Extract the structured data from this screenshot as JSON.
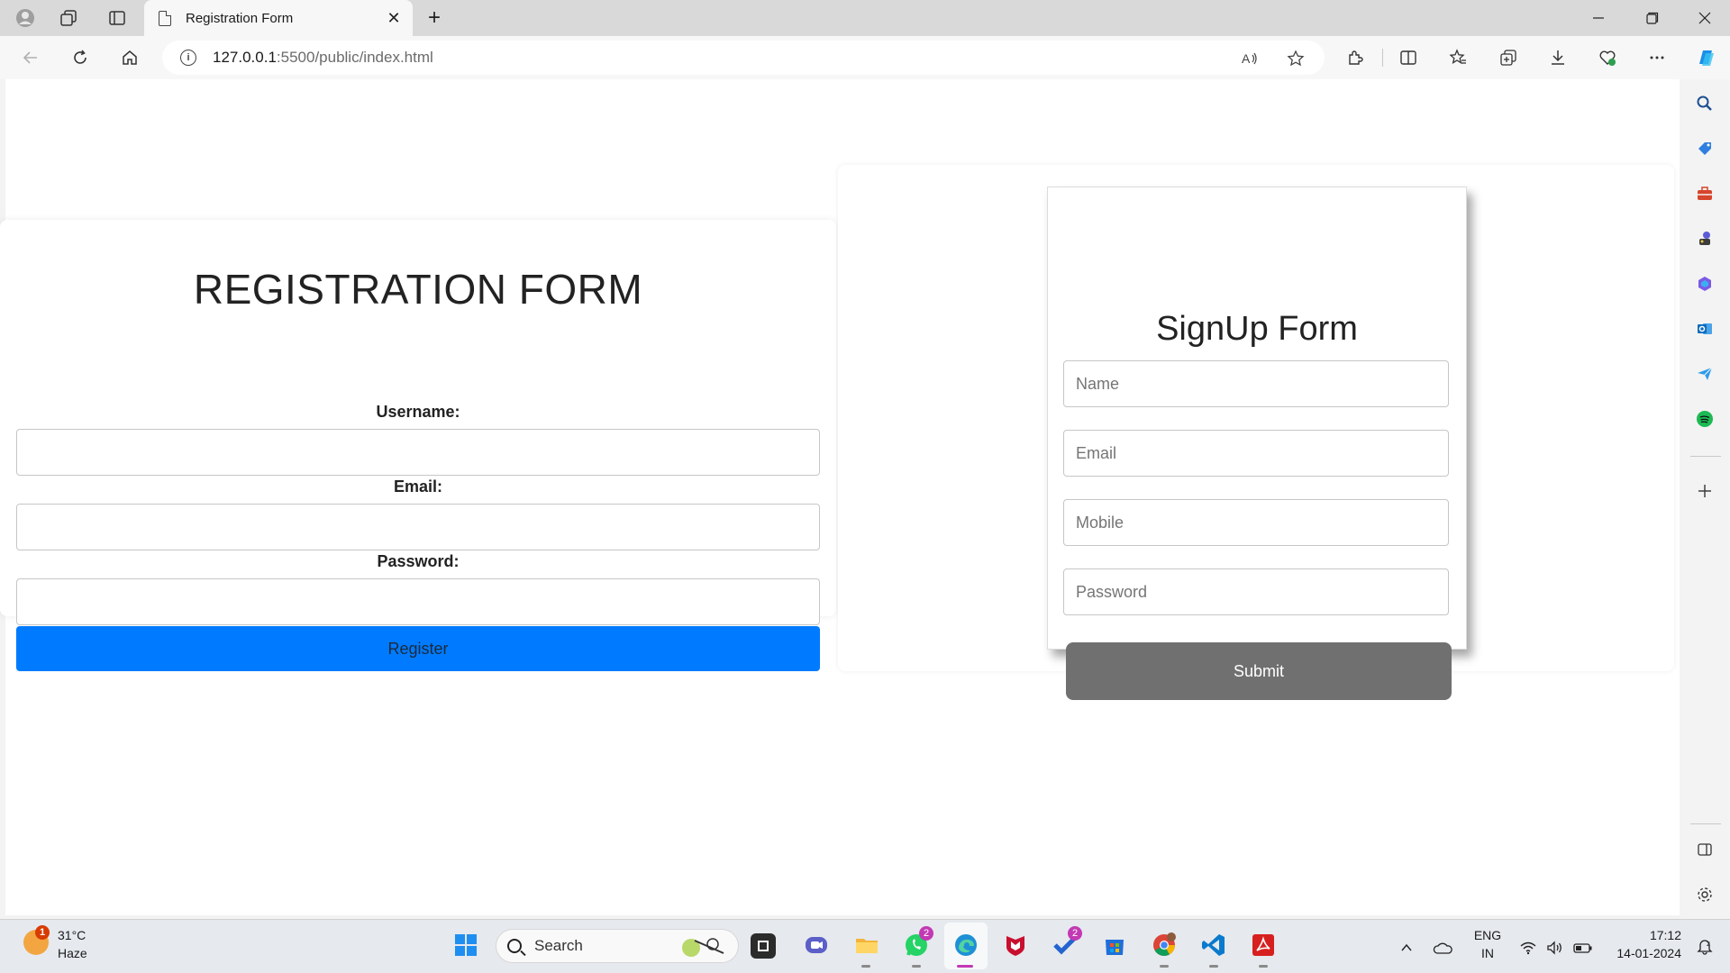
{
  "browser": {
    "tab_title": "Registration Form",
    "url_host": "127.0.0.1",
    "url_path": ":5500/public/index.html",
    "new_tab_symbol": "+",
    "close_symbol": "✕"
  },
  "registration": {
    "title": "REGISTRATION FORM",
    "username_label": "Username:",
    "email_label": "Email:",
    "password_label": "Password:",
    "username_value": "",
    "email_value": "",
    "password_value": "",
    "register_button": "Register",
    "button_color": "#007bff"
  },
  "signup": {
    "title": "SignUp Form",
    "name_placeholder": "Name",
    "email_placeholder": "Email",
    "mobile_placeholder": "Mobile",
    "password_placeholder": "Password",
    "submit_button": "Submit",
    "button_color": "#707070"
  },
  "taskbar": {
    "weather_temp": "31°C",
    "weather_desc": "Haze",
    "weather_badge": "1",
    "search_label": "Search",
    "whatsapp_badge": "2",
    "todo_badge": "2",
    "language_line1": "ENG",
    "language_line2": "IN",
    "time": "17:12",
    "date": "14-01-2024"
  }
}
